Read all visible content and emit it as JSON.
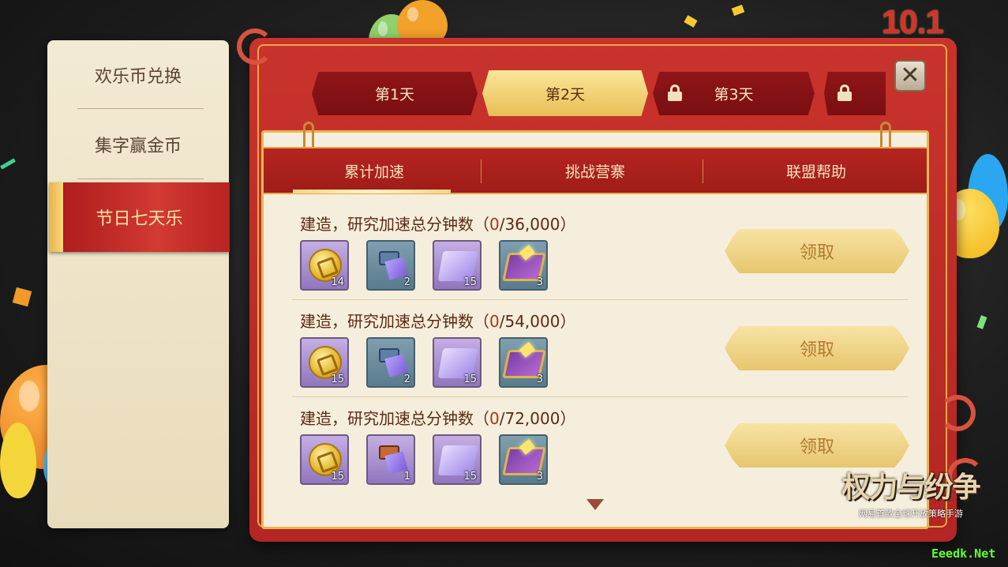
{
  "sidebar": {
    "items": [
      {
        "label": "欢乐币兑换",
        "active": false
      },
      {
        "label": "集字赢金币",
        "active": false
      },
      {
        "label": "节日七天乐",
        "active": true
      }
    ]
  },
  "banner": {
    "text": "10.1"
  },
  "day_tabs": [
    {
      "label": "第1天",
      "locked": false,
      "active": false
    },
    {
      "label": "第2天",
      "locked": false,
      "active": true
    },
    {
      "label": "第3天",
      "locked": true,
      "active": false
    },
    {
      "label": "",
      "locked": true,
      "active": false
    }
  ],
  "close_button": {
    "icon": "close-icon",
    "glyph": "✕"
  },
  "sub_tabs": [
    {
      "label": "累计加速",
      "active": true
    },
    {
      "label": "挑战营寨",
      "active": false
    },
    {
      "label": "联盟帮助",
      "active": false
    }
  ],
  "tasks": [
    {
      "title_prefix": "建造，研究加速总分钟数（",
      "progress": "0",
      "title_suffix": "/36,000）",
      "rewards": [
        {
          "icon": "gold-coin-icon",
          "count": "14"
        },
        {
          "icon": "chest-scroll-icon",
          "count": "2"
        },
        {
          "icon": "purple-scroll-icon",
          "count": "15"
        },
        {
          "icon": "magic-book-icon",
          "count": "3"
        }
      ],
      "button_label": "领取"
    },
    {
      "title_prefix": "建造，研究加速总分钟数（",
      "progress": "0",
      "title_suffix": "/54,000）",
      "rewards": [
        {
          "icon": "gold-coin-icon",
          "count": "15"
        },
        {
          "icon": "chest-scroll-icon",
          "count": "2"
        },
        {
          "icon": "purple-scroll-icon",
          "count": "15"
        },
        {
          "icon": "magic-book-icon",
          "count": "3"
        }
      ],
      "button_label": "领取"
    },
    {
      "title_prefix": "建造，研究加速总分钟数（",
      "progress": "0",
      "title_suffix": "/72,000）",
      "rewards": [
        {
          "icon": "gold-coin-icon",
          "count": "15"
        },
        {
          "icon": "gold-chest-scroll-icon",
          "count": "1"
        },
        {
          "icon": "purple-scroll-icon",
          "count": "15"
        },
        {
          "icon": "magic-book-icon",
          "count": "3"
        }
      ],
      "button_label": "领取"
    }
  ],
  "logo": {
    "title": "权力与纷争",
    "subtitle": "网易首款全球开放策略手游"
  },
  "watermark": "Eeedk.Net",
  "colors": {
    "frame_red": "#c9332c",
    "active_tab_gold": "#e8be55",
    "panel_bg": "#f6eedc",
    "text_brown": "#5b2b14",
    "claim_text": "#b27a2d"
  }
}
